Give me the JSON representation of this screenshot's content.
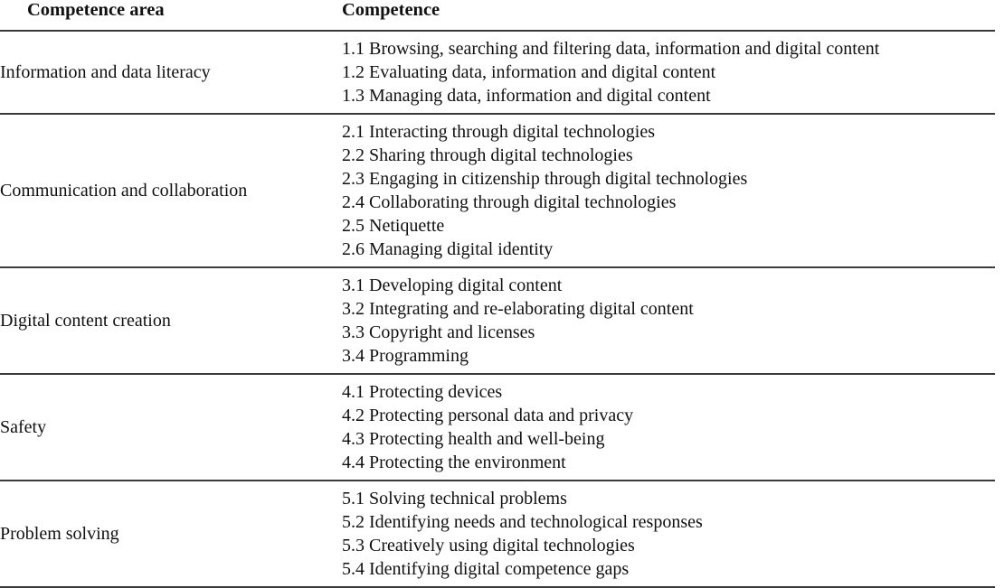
{
  "table": {
    "headers": {
      "area": "Competence area",
      "competence": "Competence"
    },
    "rows": [
      {
        "area": "Information and data literacy",
        "competences": [
          "1.1 Browsing, searching and filtering data, information and digital content",
          "1.2 Evaluating data, information and digital content",
          "1.3 Managing data, information and digital content"
        ]
      },
      {
        "area": "Communication and collaboration",
        "competences": [
          "2.1 Interacting through digital technologies",
          "2.2 Sharing through digital technologies",
          "2.3 Engaging in citizenship through digital technologies",
          "2.4 Collaborating through digital technologies",
          "2.5 Netiquette",
          "2.6 Managing digital identity"
        ]
      },
      {
        "area": "Digital content creation",
        "competences": [
          "3.1 Developing digital content",
          "3.2 Integrating and re-elaborating digital content",
          "3.3 Copyright and licenses",
          "3.4 Programming"
        ]
      },
      {
        "area": "Safety",
        "competences": [
          "4.1 Protecting devices",
          "4.2 Protecting personal data and privacy",
          "4.3 Protecting health and well-being",
          "4.4 Protecting the environment"
        ]
      },
      {
        "area": "Problem solving",
        "competences": [
          "5.1 Solving technical problems",
          "5.2 Identifying needs and technological responses",
          "5.3 Creatively using digital technologies",
          "5.4 Identifying digital competence gaps"
        ]
      }
    ]
  },
  "style": {
    "rule_color": "#3a3a3a",
    "text_color": "#101010",
    "background": "#ffffff"
  }
}
